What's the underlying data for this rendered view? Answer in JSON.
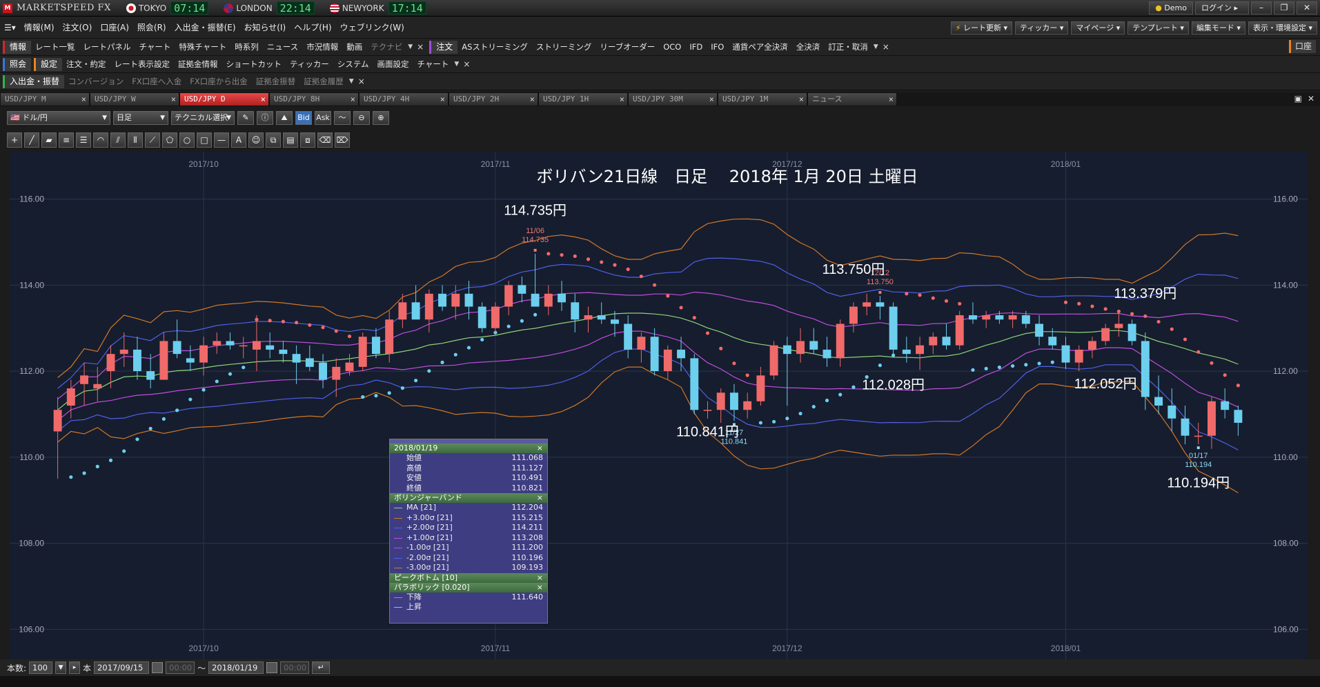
{
  "titlebar": {
    "brand": "MARKETSPEED FX",
    "clocks": [
      {
        "city": "TOKYO",
        "time": "07:14",
        "flag_color": "#ffffff"
      },
      {
        "city": "LONDON",
        "time": "22:14",
        "flag_color": "#2a3f8f"
      },
      {
        "city": "NEWYORK",
        "time": "17:14",
        "flag_color": "#3a5fb0"
      }
    ],
    "demo_label": "Demo",
    "login_label": "ログイン"
  },
  "menu": [
    "情報(M)",
    "注文(O)",
    "口座(A)",
    "照会(R)",
    "入出金・振替(E)",
    "お知らせ(I)",
    "ヘルプ(H)",
    "ウェブリンク(W)"
  ],
  "right_menus": [
    "レート更新",
    "ティッカー",
    "マイページ",
    "テンプレート",
    "編集モード",
    "表示・環境設定"
  ],
  "row1": {
    "group_info": "情報",
    "info_items": [
      "レート一覧",
      "レートパネル",
      "チャート",
      "特殊チャート",
      "時系列",
      "ニュース",
      "市況情報",
      "動画",
      "テクナビ"
    ],
    "group_order": "注文",
    "order_items": [
      "ASストリーミング",
      "ストリーミング",
      "リーブオーダー",
      "OCO",
      "IFD",
      "IFO",
      "通貨ペア全決済",
      "全決済",
      "訂正・取消"
    ],
    "kouza": "口座"
  },
  "row2": {
    "group_query": "照会",
    "group_settings": "設定",
    "settings_items": [
      "注文・約定",
      "レート表示設定",
      "証拠金情報",
      "ショートカット",
      "ティッカー",
      "システム",
      "画面設定",
      "チャート"
    ]
  },
  "row3": {
    "group": "入出金・振替",
    "items": [
      "コンバージョン",
      "FX口座へ入金",
      "FX口座から出金",
      "証拠金振替",
      "証拠金履歴"
    ]
  },
  "tabs": [
    {
      "label": "USD/JPY M",
      "active": false
    },
    {
      "label": "USD/JPY W",
      "active": false
    },
    {
      "label": "USD/JPY D",
      "active": true
    },
    {
      "label": "USD/JPY 8H",
      "active": false
    },
    {
      "label": "USD/JPY 4H",
      "active": false
    },
    {
      "label": "USD/JPY 2H",
      "active": false
    },
    {
      "label": "USD/JPY 1H",
      "active": false
    },
    {
      "label": "USD/JPY 30M",
      "active": false
    },
    {
      "label": "USD/JPY 1M",
      "active": false
    },
    {
      "label": "ニュース",
      "active": false
    }
  ],
  "chart_toolbar": {
    "pair": "ドル/円",
    "period": "日足",
    "technical": "テクニカル選択",
    "bid": "Bid",
    "ask": "Ask"
  },
  "chart_data": {
    "type": "candlestick",
    "title": "ボリバン21日線　日足　 2018年 1月 20日 土曜日",
    "x_labels": [
      "2017/10",
      "2017/11",
      "2017/12",
      "2018/01"
    ],
    "y_ticks": [
      "116.00",
      "114.00",
      "112.00",
      "110.00",
      "108.00",
      "106.00"
    ],
    "ylim": [
      105.3,
      117.1
    ],
    "annotations": [
      {
        "text": "114.735円",
        "price": 114.735
      },
      {
        "text": "113.750円",
        "price": 113.75
      },
      {
        "text": "113.379円",
        "price": 113.379
      },
      {
        "text": "112.028円",
        "price": 112.028
      },
      {
        "text": "112.052円",
        "price": 112.052
      },
      {
        "text": "110.841円",
        "price": 110.841
      },
      {
        "text": "110.194円",
        "price": 110.194
      }
    ],
    "small_labels": [
      {
        "date": "11/06",
        "price": "114.735",
        "type": "high"
      },
      {
        "date": "12/12",
        "price": "113.750",
        "type": "high"
      },
      {
        "date": "11/27",
        "price": "110.841",
        "type": "low"
      },
      {
        "date": "01/17",
        "price": "110.194",
        "type": "low"
      }
    ],
    "colors": {
      "up": "#f06a6a",
      "down": "#6ccfee",
      "ma": "#8fd47a",
      "sigma1": "#c04ee0",
      "sigma2": "#5060e8",
      "sigma3": "#d07828",
      "sar_down": "#f06a6a",
      "sar_up": "#6ccfee"
    },
    "candles": [
      [
        110.6,
        111.4,
        109.5,
        111.1
      ],
      [
        111.2,
        111.8,
        110.9,
        111.6
      ],
      [
        111.7,
        112.2,
        111.2,
        111.9
      ],
      [
        111.6,
        112.1,
        111.3,
        111.7
      ],
      [
        112.0,
        112.6,
        111.6,
        112.4
      ],
      [
        112.4,
        112.9,
        112.1,
        112.5
      ],
      [
        112.5,
        112.8,
        111.8,
        112.0
      ],
      [
        112.0,
        112.4,
        111.6,
        111.8
      ],
      [
        111.8,
        112.9,
        111.8,
        112.7
      ],
      [
        112.7,
        113.2,
        112.3,
        112.4
      ],
      [
        112.3,
        112.6,
        112.0,
        112.2
      ],
      [
        112.2,
        112.8,
        111.9,
        112.6
      ],
      [
        112.6,
        112.9,
        112.4,
        112.7
      ],
      [
        112.7,
        112.9,
        112.5,
        112.6
      ],
      [
        112.6,
        112.8,
        112.3,
        112.6
      ],
      [
        112.5,
        113.3,
        112.0,
        112.7
      ],
      [
        112.6,
        112.9,
        112.3,
        112.5
      ],
      [
        112.5,
        112.7,
        112.2,
        112.4
      ],
      [
        112.4,
        112.6,
        111.7,
        112.2
      ],
      [
        112.3,
        112.6,
        112.0,
        112.1
      ],
      [
        112.2,
        112.4,
        111.6,
        111.8
      ],
      [
        111.8,
        112.3,
        111.4,
        112.1
      ],
      [
        112.0,
        112.4,
        111.9,
        112.2
      ],
      [
        112.1,
        112.9,
        112.0,
        112.8
      ],
      [
        112.8,
        113.0,
        112.3,
        112.4
      ],
      [
        112.4,
        113.4,
        112.2,
        113.2
      ],
      [
        113.2,
        113.8,
        113.0,
        113.6
      ],
      [
        113.6,
        114.0,
        113.3,
        113.2
      ],
      [
        113.2,
        113.9,
        112.9,
        113.8
      ],
      [
        113.8,
        114.0,
        113.4,
        113.5
      ],
      [
        113.5,
        114.0,
        113.2,
        113.8
      ],
      [
        113.8,
        114.1,
        113.2,
        113.5
      ],
      [
        113.5,
        113.6,
        112.9,
        113.0
      ],
      [
        113.0,
        113.6,
        112.9,
        113.5
      ],
      [
        113.5,
        114.1,
        113.3,
        114.0
      ],
      [
        114.0,
        114.2,
        113.6,
        113.8
      ],
      [
        113.8,
        114.73,
        113.7,
        113.5
      ],
      [
        113.5,
        114.0,
        113.3,
        113.8
      ],
      [
        113.8,
        114.1,
        113.4,
        113.6
      ],
      [
        113.6,
        113.8,
        112.9,
        113.2
      ],
      [
        113.2,
        113.5,
        112.9,
        113.3
      ],
      [
        113.3,
        113.6,
        113.1,
        113.2
      ],
      [
        113.2,
        113.4,
        112.8,
        113.1
      ],
      [
        113.1,
        113.3,
        112.3,
        112.5
      ],
      [
        112.5,
        112.9,
        112.2,
        112.8
      ],
      [
        112.8,
        113.0,
        111.9,
        112.0
      ],
      [
        112.0,
        112.6,
        111.8,
        112.5
      ],
      [
        112.5,
        112.8,
        112.0,
        112.3
      ],
      [
        112.3,
        112.4,
        111.0,
        111.1
      ],
      [
        111.1,
        111.3,
        110.9,
        111.1
      ],
      [
        111.1,
        111.6,
        110.8,
        111.5
      ],
      [
        111.5,
        111.7,
        110.841,
        111.1
      ],
      [
        111.1,
        111.5,
        110.9,
        111.3
      ],
      [
        111.3,
        112.1,
        111.2,
        111.9
      ],
      [
        111.9,
        112.7,
        111.8,
        112.6
      ],
      [
        112.6,
        112.8,
        111.2,
        112.4
      ],
      [
        112.4,
        113.0,
        112.2,
        112.7
      ],
      [
        112.7,
        113.0,
        112.4,
        112.5
      ],
      [
        112.5,
        112.8,
        112.1,
        112.3
      ],
      [
        112.3,
        113.2,
        112.1,
        113.1
      ],
      [
        113.1,
        113.6,
        112.9,
        113.5
      ],
      [
        113.5,
        113.8,
        113.3,
        113.6
      ],
      [
        113.6,
        113.75,
        113.2,
        113.5
      ],
      [
        113.5,
        113.6,
        112.4,
        112.5
      ],
      [
        112.5,
        112.8,
        112.2,
        112.4
      ],
      [
        112.4,
        112.8,
        112.028,
        112.6
      ],
      [
        112.6,
        112.9,
        112.4,
        112.8
      ],
      [
        112.8,
        113.1,
        112.5,
        112.6
      ],
      [
        112.6,
        113.4,
        112.5,
        113.3
      ],
      [
        113.3,
        113.6,
        113.1,
        113.2
      ],
      [
        113.2,
        113.4,
        113.0,
        113.3
      ],
      [
        113.3,
        113.4,
        113.1,
        113.2
      ],
      [
        113.2,
        113.4,
        113.0,
        113.3
      ],
      [
        113.3,
        113.4,
        113.0,
        113.1
      ],
      [
        113.1,
        113.3,
        112.6,
        112.8
      ],
      [
        112.8,
        113.0,
        112.5,
        112.6
      ],
      [
        112.6,
        112.8,
        112.052,
        112.2
      ],
      [
        112.2,
        112.6,
        112.0,
        112.5
      ],
      [
        112.5,
        112.8,
        112.3,
        112.7
      ],
      [
        112.7,
        113.1,
        112.6,
        113.0
      ],
      [
        113.0,
        113.379,
        112.8,
        113.1
      ],
      [
        113.1,
        113.2,
        112.6,
        112.7
      ],
      [
        112.7,
        112.9,
        111.1,
        111.4
      ],
      [
        111.4,
        111.9,
        111.0,
        111.2
      ],
      [
        111.2,
        111.6,
        110.6,
        110.9
      ],
      [
        110.9,
        111.2,
        110.3,
        110.5
      ],
      [
        110.5,
        110.8,
        110.3,
        110.5
      ],
      [
        110.5,
        111.4,
        110.194,
        111.3
      ],
      [
        111.3,
        111.6,
        110.9,
        111.1
      ],
      [
        111.1,
        111.2,
        110.5,
        110.8
      ]
    ]
  },
  "info_panel": {
    "date": "2018/01/19",
    "ohlc": [
      {
        "label": "始値",
        "value": "111.068"
      },
      {
        "label": "高値",
        "value": "111.127"
      },
      {
        "label": "安値",
        "value": "110.491"
      },
      {
        "label": "終値",
        "value": "110.821"
      }
    ],
    "bb_header": "ボリンジャーバンド",
    "bb_rows": [
      {
        "label": "MA [21]",
        "value": "112.204",
        "color": "#8fd47a"
      },
      {
        "label": "+3.00σ [21]",
        "value": "115.215",
        "color": "#d07828"
      },
      {
        "label": "+2.00σ [21]",
        "value": "114.211",
        "color": "#5060e8"
      },
      {
        "label": "+1.00σ [21]",
        "value": "113.208",
        "color": "#c04ee0"
      },
      {
        "label": "-1.00σ [21]",
        "value": "111.200",
        "color": "#c04ee0"
      },
      {
        "label": "-2.00σ [21]",
        "value": "110.196",
        "color": "#5060e8"
      },
      {
        "label": "-3.00σ [21]",
        "value": "109.193",
        "color": "#d07828"
      }
    ],
    "peak_header": "ピークボトム [10]",
    "sar_header": "パラボリック [0.020]",
    "sar_rows": [
      {
        "label": "下降",
        "value": "111.640",
        "color": "#f06a6a"
      },
      {
        "label": "上昇",
        "value": "",
        "color": "#6ccfee"
      }
    ]
  },
  "bottom": {
    "count_label": "本数:",
    "count_value": "100",
    "unit": "本",
    "from_date": "2017/09/15",
    "from_time": "00:00",
    "tilde": "〜",
    "to_date": "2018/01/19",
    "to_time": "00:00"
  }
}
